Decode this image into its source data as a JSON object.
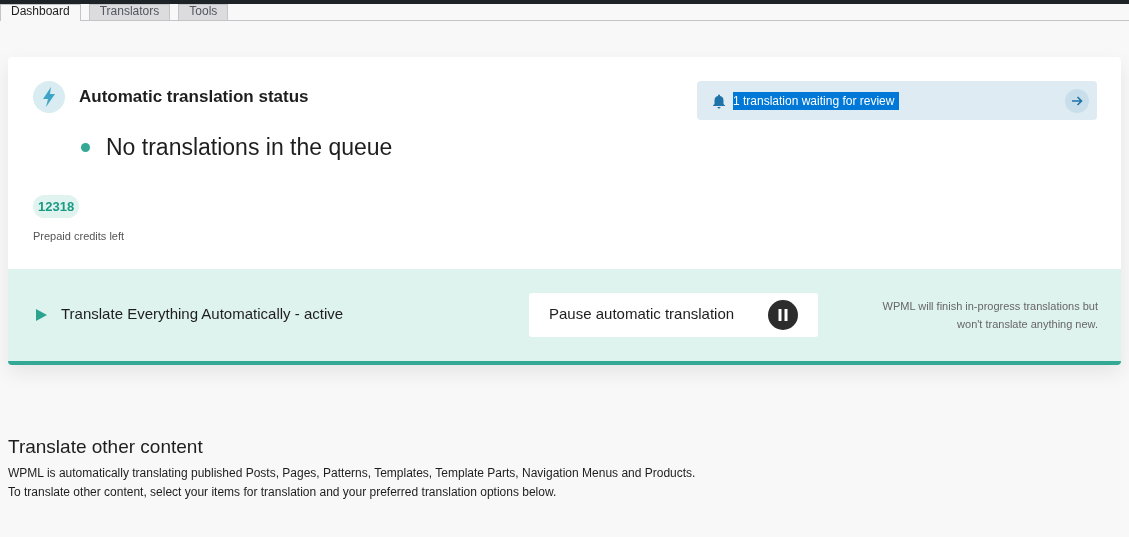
{
  "tabs": [
    {
      "label": "Dashboard",
      "selected": true
    },
    {
      "label": "Translators",
      "selected": false
    },
    {
      "label": "Tools",
      "selected": false
    }
  ],
  "status_card": {
    "title": "Automatic translation status",
    "notification": "1 translation waiting for review",
    "queue_status": "No translations in the queue",
    "credits": "12318",
    "credits_label": "Prepaid credits left"
  },
  "automation_bar": {
    "label": "Translate Everything Automatically - active",
    "active": true,
    "pause_button": "Pause automatic translation",
    "note": "WPML will finish in-progress translations but won't translate anything new."
  },
  "other_content": {
    "title": "Translate other content",
    "lines": [
      "WPML is automatically translating published Posts, Pages, Patterns, Templates, Template Parts, Navigation Menus and Products.",
      "To translate other content, select your items for translation and your preferred translation options below."
    ]
  }
}
